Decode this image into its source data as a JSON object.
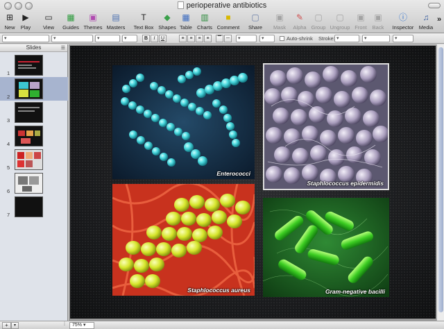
{
  "window": {
    "title": "perioperative antibiotics"
  },
  "toolbar": {
    "new": "New",
    "play": "Play",
    "view": "View",
    "guides": "Guides",
    "themes": "Themes",
    "masters": "Masters",
    "text_box": "Text Box",
    "shapes": "Shapes",
    "table": "Table",
    "charts": "Charts",
    "comment": "Comment",
    "share": "Share",
    "mask": "Mask",
    "alpha": "Alpha",
    "group": "Group",
    "ungroup": "Ungroup",
    "front": "Front",
    "back": "Back",
    "inspector": "Inspector",
    "media": "Media",
    "overflow": "»"
  },
  "formatbar": {
    "bold": "B",
    "italic": "I",
    "underline": "U",
    "auto_shrink": "Auto-shrink",
    "stroke": "Stroke:"
  },
  "sidebar": {
    "header": "Slides",
    "selected_index": 2,
    "slides": [
      {
        "number": "1"
      },
      {
        "number": "2"
      },
      {
        "number": "3"
      },
      {
        "number": "4"
      },
      {
        "number": "5"
      },
      {
        "number": "6"
      },
      {
        "number": "7"
      }
    ]
  },
  "slide": {
    "images": [
      {
        "caption": "Enterococci"
      },
      {
        "caption": "Staphlococcus epidermidis"
      },
      {
        "caption": "Staphlococcus aureus"
      },
      {
        "caption": "Gram-negative bacilli"
      }
    ]
  },
  "statusbar": {
    "zoom": "75%",
    "add": "+",
    "options": "▾"
  }
}
